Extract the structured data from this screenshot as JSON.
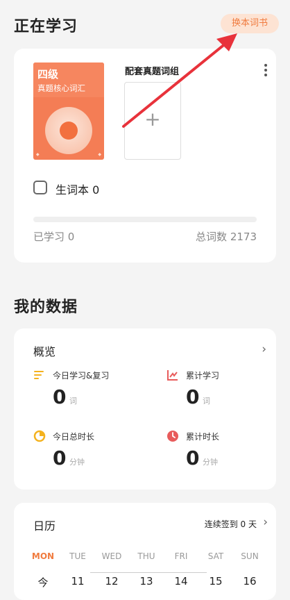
{
  "header": {
    "title": "正在学习",
    "switch_button": "换本词书"
  },
  "book": {
    "cover_level": "四级",
    "cover_subtitle": "真题核心词汇",
    "match_title": "配套真题词组",
    "add_symbol": "+",
    "vocab_label": "生词本 0",
    "learned": "已学习 0",
    "total": "总词数 2173",
    "progress": 0
  },
  "data_section": {
    "title": "我的数据"
  },
  "overview": {
    "title": "概览",
    "stats": [
      {
        "label": "今日学习&复习",
        "value": "0",
        "unit": "词",
        "icon": "list-icon",
        "color": "#f4b21e"
      },
      {
        "label": "累计学习",
        "value": "0",
        "unit": "词",
        "icon": "trend-chart-icon",
        "color": "#e85b5b"
      },
      {
        "label": "今日总时长",
        "value": "0",
        "unit": "分钟",
        "icon": "timer-icon",
        "color": "#f4b21e"
      },
      {
        "label": "累计时长",
        "value": "0",
        "unit": "分钟",
        "icon": "clock-icon",
        "color": "#e85b5b"
      }
    ]
  },
  "calendar": {
    "title": "日历",
    "streak": "连续签到 0 天",
    "weekdays": [
      "MON",
      "TUE",
      "WED",
      "THU",
      "FRI",
      "SAT",
      "SUN"
    ],
    "dates": [
      "今",
      "11",
      "12",
      "13",
      "14",
      "15",
      "16"
    ]
  },
  "colors": {
    "accent": "#f07b3f",
    "cover": "#f47d55",
    "arrow": "#e8323b"
  }
}
